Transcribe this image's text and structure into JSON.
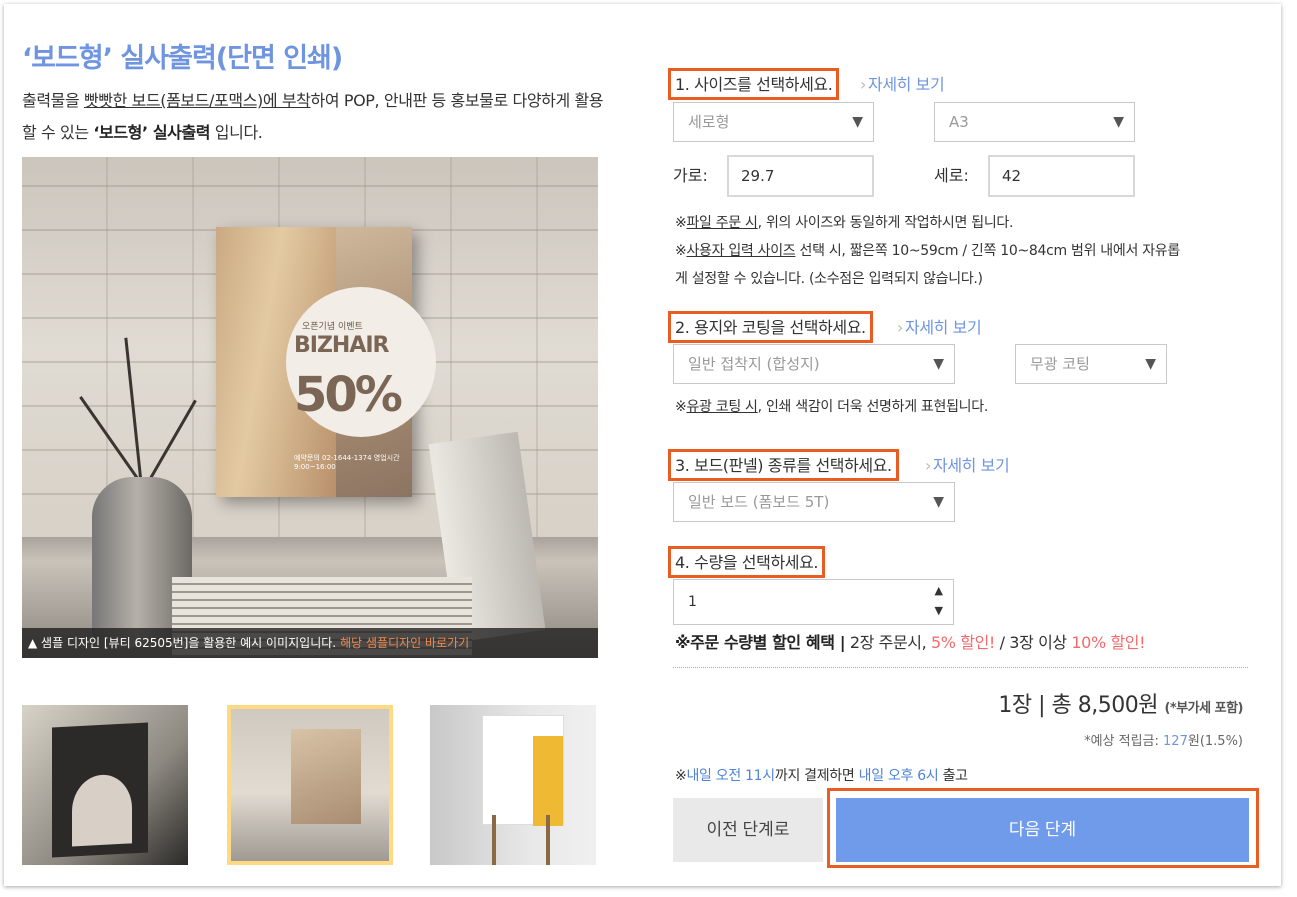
{
  "product": {
    "title": "‘보드형’ 실사출력(단면 인쇄)",
    "desc_part1": "출력물을 ",
    "desc_underlined": "빳빳한 보드(폼보드/포맥스)에 부착",
    "desc_part2": "하여 POP, 안내판 등 홍보물로 다양하게 활용할 수 있는 ",
    "desc_bold": "‘보드형’ 실사출력",
    "desc_part3": " 입니다."
  },
  "preview": {
    "poster_event": "오픈기념 이벤트",
    "poster_brand": "BIZHAIR",
    "poster_discount": "50%",
    "poster_contact": "예약문의 02-1644-1374   영업시간 9:00~16:00",
    "caption": "▲ 샘플 디자인 [뷰티 62505번]을 활용한 예시 이미지입니다.",
    "caption_link": "해당 샘플디자인 바로가기"
  },
  "step1": {
    "label": "1. 사이즈를 선택하세요.",
    "more": "자세히 보기",
    "orientation": "세로형",
    "size": "A3",
    "width_label": "가로:",
    "width_value": "29.7",
    "height_label": "세로:",
    "height_value": "42",
    "note1_u": "파일 주문 시",
    "note1": ", 위의 사이즈와 동일하게 작업하시면 됩니다.",
    "note2_u": "사용자 입력 사이즈",
    "note2a": " 선택 시, 짧은쪽 10~59cm / 긴쪽 10~84cm 범위 내에서 자유롭",
    "note2b": "게 설정할 수 있습니다. (소수점은 입력되지 않습니다.)"
  },
  "step2": {
    "label": "2. 용지와 코팅을 선택하세요.",
    "more": "자세히 보기",
    "paper": "일반 접착지 (합성지)",
    "coating": "무광 코팅",
    "note_u": "유광 코팅 시",
    "note": ", 인쇄 색감이 더욱 선명하게 표현됩니다."
  },
  "step3": {
    "label": "3. 보드(판넬) 종류를 선택하세요.",
    "more": "자세히 보기",
    "board": "일반 보드 (폼보드 5T)"
  },
  "step4": {
    "label": "4. 수량을 선택하세요.",
    "quantity": "1"
  },
  "discount": {
    "title": "※주문 수량별 할인 혜택 |",
    "text1": " 2장 주문시, ",
    "red1": "5% 할인!",
    "text2": " / 3장 이상 ",
    "red2": "10% 할인!"
  },
  "summary": {
    "total": "1장  |  총 8,500원",
    "vat": "(*부가세 포함)",
    "points_label": "*예상 적립금: ",
    "points_value": "127",
    "points_suffix": "원(1.5%)"
  },
  "shipping": {
    "prefix": "※",
    "time1": "내일 오전 11시",
    "mid": "까지 결제하면 ",
    "time2": "내일 오후 6시",
    "suffix": " 출고"
  },
  "buttons": {
    "prev": "이전 단계로",
    "next": "다음 단계"
  },
  "colors": {
    "accent": "#6f95e0",
    "highlight_border": "#e95d23",
    "discount_red": "#f36b6b",
    "next_button": "#6f9bea"
  }
}
